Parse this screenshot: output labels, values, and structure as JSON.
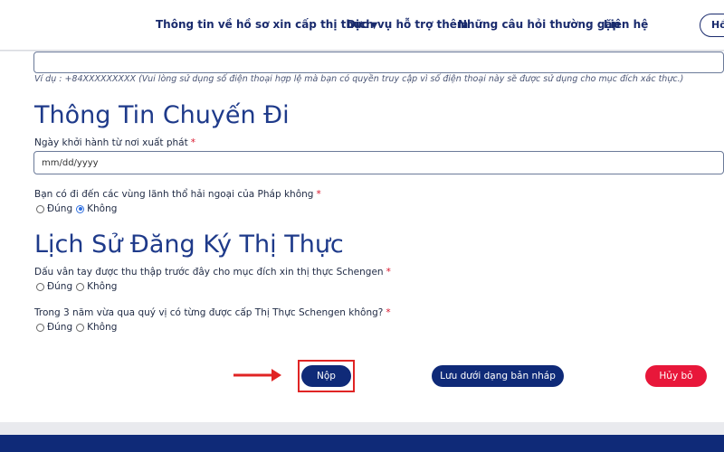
{
  "nav": {
    "items": [
      {
        "label": "Thông tin về hồ sơ xin cấp thị thực",
        "has_dropdown": true
      },
      {
        "label": "Dịch vụ hỗ trợ thêm"
      },
      {
        "label": "Những câu hỏi thường gặp"
      },
      {
        "label": "Liên hệ"
      }
    ],
    "header_button_label": "Hồ"
  },
  "phone": {
    "hint": "Ví dụ : +84XXXXXXXXX (Vui lòng sử dụng số điện thoại hợp lệ mà bạn có quyền truy cập vì số điện thoại này sẽ được sử dụng cho mục đích xác thực.)"
  },
  "trip": {
    "title": "Thông Tin Chuyến Đi",
    "departure_label": "Ngày khởi hành từ nơi xuất phát",
    "departure_placeholder": "mm/dd/yyyy",
    "overseas_label": "Bạn có đi đến các vùng lãnh thổ hải ngoại của Pháp không",
    "overseas_selected": "Không"
  },
  "history": {
    "title": "Lịch Sử Đăng Ký Thị Thực",
    "fingerprint_label": "Dấu vân tay được thu thập trước đây cho mục đích xin thị thực Schengen",
    "previous_visa_label": "Trong 3 năm vừa qua quý vị có từng được cấp Thị Thực Schengen không?"
  },
  "options": {
    "yes": "Đúng",
    "no": "Không"
  },
  "required_marker": "*",
  "actions": {
    "submit": "Nộp",
    "save_draft": "Lưu dưới dạng bản nháp",
    "cancel": "Hủy bỏ"
  },
  "colors": {
    "brand_navy": "#0f2a78",
    "title_blue": "#1e3a8a",
    "cancel_red": "#e8173a",
    "annotation_red": "#e02424",
    "radio_blue": "#2f6fe0"
  }
}
